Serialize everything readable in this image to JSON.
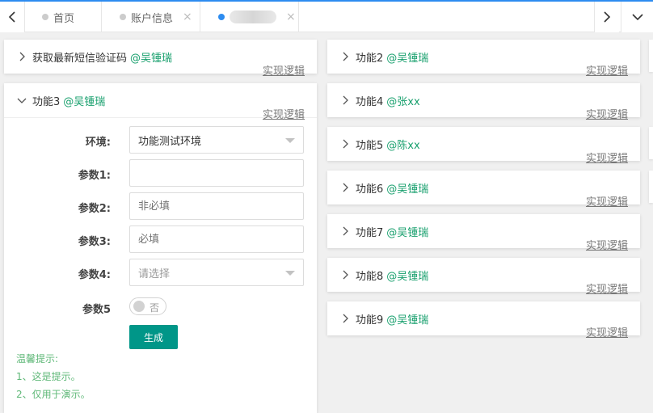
{
  "tabs": [
    {
      "label": "首页",
      "closable": false,
      "active": false
    },
    {
      "label": "账户信息",
      "closable": true,
      "active": false
    },
    {
      "label": "████",
      "closable": true,
      "active": true,
      "blurred": true
    }
  ],
  "tab_nav": {
    "prev_icon": "chevron-left-icon",
    "next_icon": "chevron-right-icon",
    "menu_icon": "chevron-down-icon",
    "close_glyph": "×"
  },
  "logic_link_label": "实现逻辑",
  "left_cards": [
    {
      "title": "获取最新短信验证码",
      "author": "@吴锺瑞",
      "expanded": false
    }
  ],
  "expanded_card": {
    "title": "功能3",
    "author": "@吴锺瑞",
    "expanded": true,
    "form": {
      "env": {
        "label": "环境:",
        "value": "功能测试环境"
      },
      "param1": {
        "label": "参数1:",
        "value": "",
        "placeholder": ""
      },
      "param2": {
        "label": "参数2:",
        "value": "",
        "placeholder": "非必填"
      },
      "param3": {
        "label": "参数3:",
        "value": "",
        "placeholder": "必填"
      },
      "param4": {
        "label": "参数4:",
        "value": "请选择"
      },
      "param5": {
        "label": "参数5",
        "toggle_text": "否",
        "on": false
      },
      "submit_label": "生成"
    },
    "tips": [
      "温馨提示:",
      "1、这是提示。",
      "2、仅用于演示。"
    ]
  },
  "right_cards": [
    {
      "title": "功能2",
      "author": "@吴锺瑞"
    },
    {
      "title": "功能4",
      "author": "@张xx"
    },
    {
      "title": "功能5",
      "author": "@陈xx"
    },
    {
      "title": "功能6",
      "author": "@吴锺瑞"
    },
    {
      "title": "功能7",
      "author": "@吴锺瑞"
    },
    {
      "title": "功能8",
      "author": "@吴锺瑞"
    },
    {
      "title": "功能9",
      "author": "@吴锺瑞"
    }
  ],
  "colors": {
    "accent": "#2d8cf0",
    "author": "#19a06e",
    "button": "#009688",
    "tips": "#5fb878"
  }
}
